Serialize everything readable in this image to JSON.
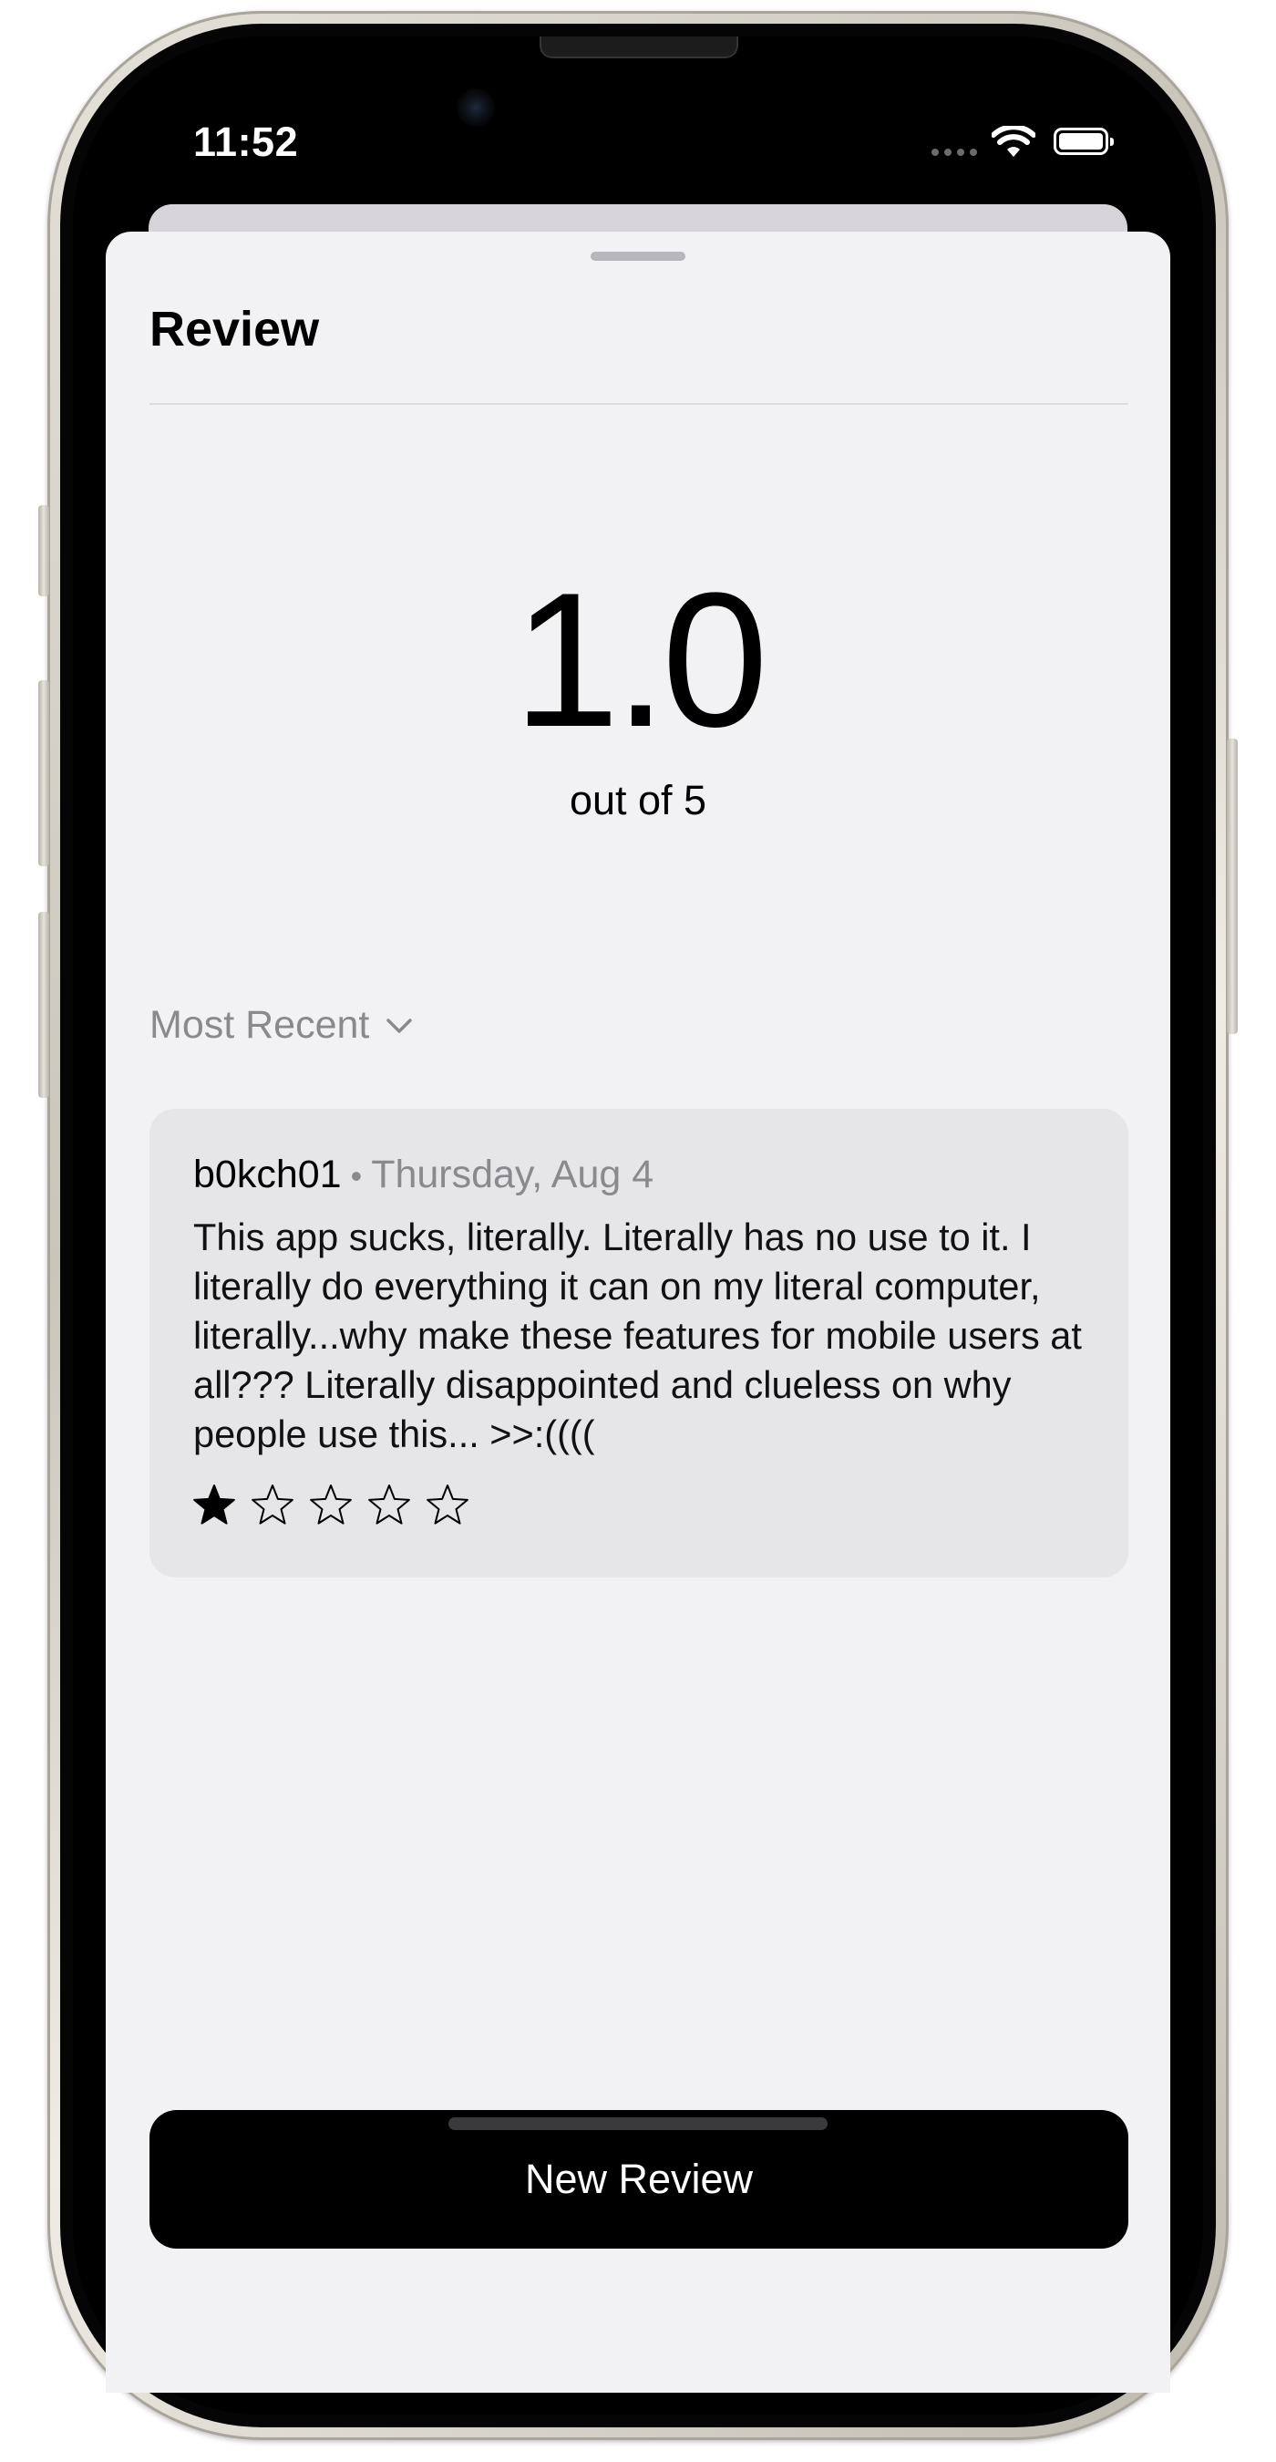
{
  "status_bar": {
    "time": "11:52"
  },
  "sheet": {
    "title": "Review"
  },
  "rating": {
    "value": "1.0",
    "subtitle": "out of 5"
  },
  "sort": {
    "label": "Most Recent",
    "icon": "chevron-down-icon"
  },
  "reviews": [
    {
      "author": "b0kch01",
      "separator": "•",
      "date": "Thursday, Aug 4",
      "text": "This app sucks, literally. Literally has no use to it. I literally do everything it can on my literal computer, literally...why make these features for mobile users at all??? Literally disappointed and clueless on why people use this... >>:((((",
      "stars": 1,
      "max_stars": 5
    }
  ],
  "actions": {
    "new_review_label": "New Review"
  },
  "colors": {
    "sheet_background": "#f2f2f4",
    "card_background": "#e6e6e9",
    "secondary_text": "#8a8a8e",
    "button_background": "#000000",
    "button_text": "#ffffff"
  }
}
